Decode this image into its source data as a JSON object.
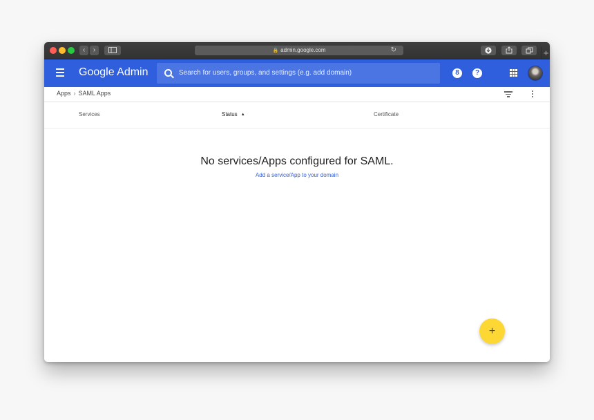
{
  "browser": {
    "address": "admin.google.com",
    "back_glyph": "‹",
    "forward_glyph": "›",
    "new_tab_glyph": "+"
  },
  "header": {
    "brand": "Google Admin",
    "search_placeholder": "Search for users, groups, and settings (e.g. add domain)",
    "support_badge": "8",
    "help_glyph": "?",
    "color": "#2f5fdc"
  },
  "breadcrumb": {
    "items": [
      "Apps",
      "SAML Apps"
    ],
    "separator": "›"
  },
  "table": {
    "columns": [
      "Services",
      "Status",
      "Certificate"
    ],
    "sort_indicator": "▲"
  },
  "empty_state": {
    "title": "No services/Apps configured for SAML.",
    "link": "Add a service/App to your domain"
  },
  "fab": {
    "glyph": "+",
    "color": "#fdd835"
  }
}
